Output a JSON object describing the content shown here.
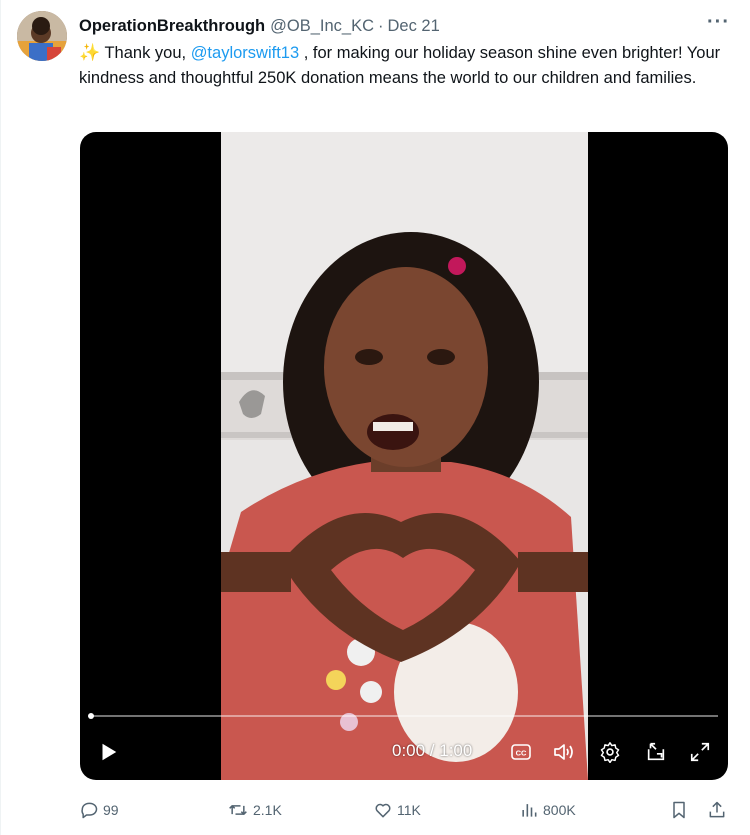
{
  "tweet": {
    "display_name": "OperationBreakthrough",
    "handle": "@OB_Inc_KC",
    "separator": "·",
    "date": "Dec 21",
    "more_label": "···",
    "avatar_icon": "profile-photo",
    "text_part1": " Thank you, ",
    "mention": "@taylorswift13",
    "text_part2": " , for making our holiday season shine even brighter! Your kindness and thoughtful 250K donation means the world to our children and families.",
    "sparkle_emoji": "✨"
  },
  "video": {
    "current_time": "0:00",
    "duration": "1:00",
    "time_display": "0:00 / 1:00",
    "progress": 0,
    "controls": [
      "play-icon",
      "captions-icon",
      "volume-icon",
      "settings-icon",
      "pop-out-icon",
      "fullscreen-icon"
    ]
  },
  "actions": {
    "replies": "99",
    "reposts": "2.1K",
    "likes": "11K",
    "views": "800K",
    "icons": [
      "reply-icon",
      "repost-icon",
      "like-icon",
      "views-icon",
      "bookmark-icon",
      "share-icon"
    ]
  },
  "colors": {
    "accent": "#1d9bf0",
    "secondary_text": "#536471",
    "primary_text": "#0f1419",
    "video_bg": "#000000"
  }
}
